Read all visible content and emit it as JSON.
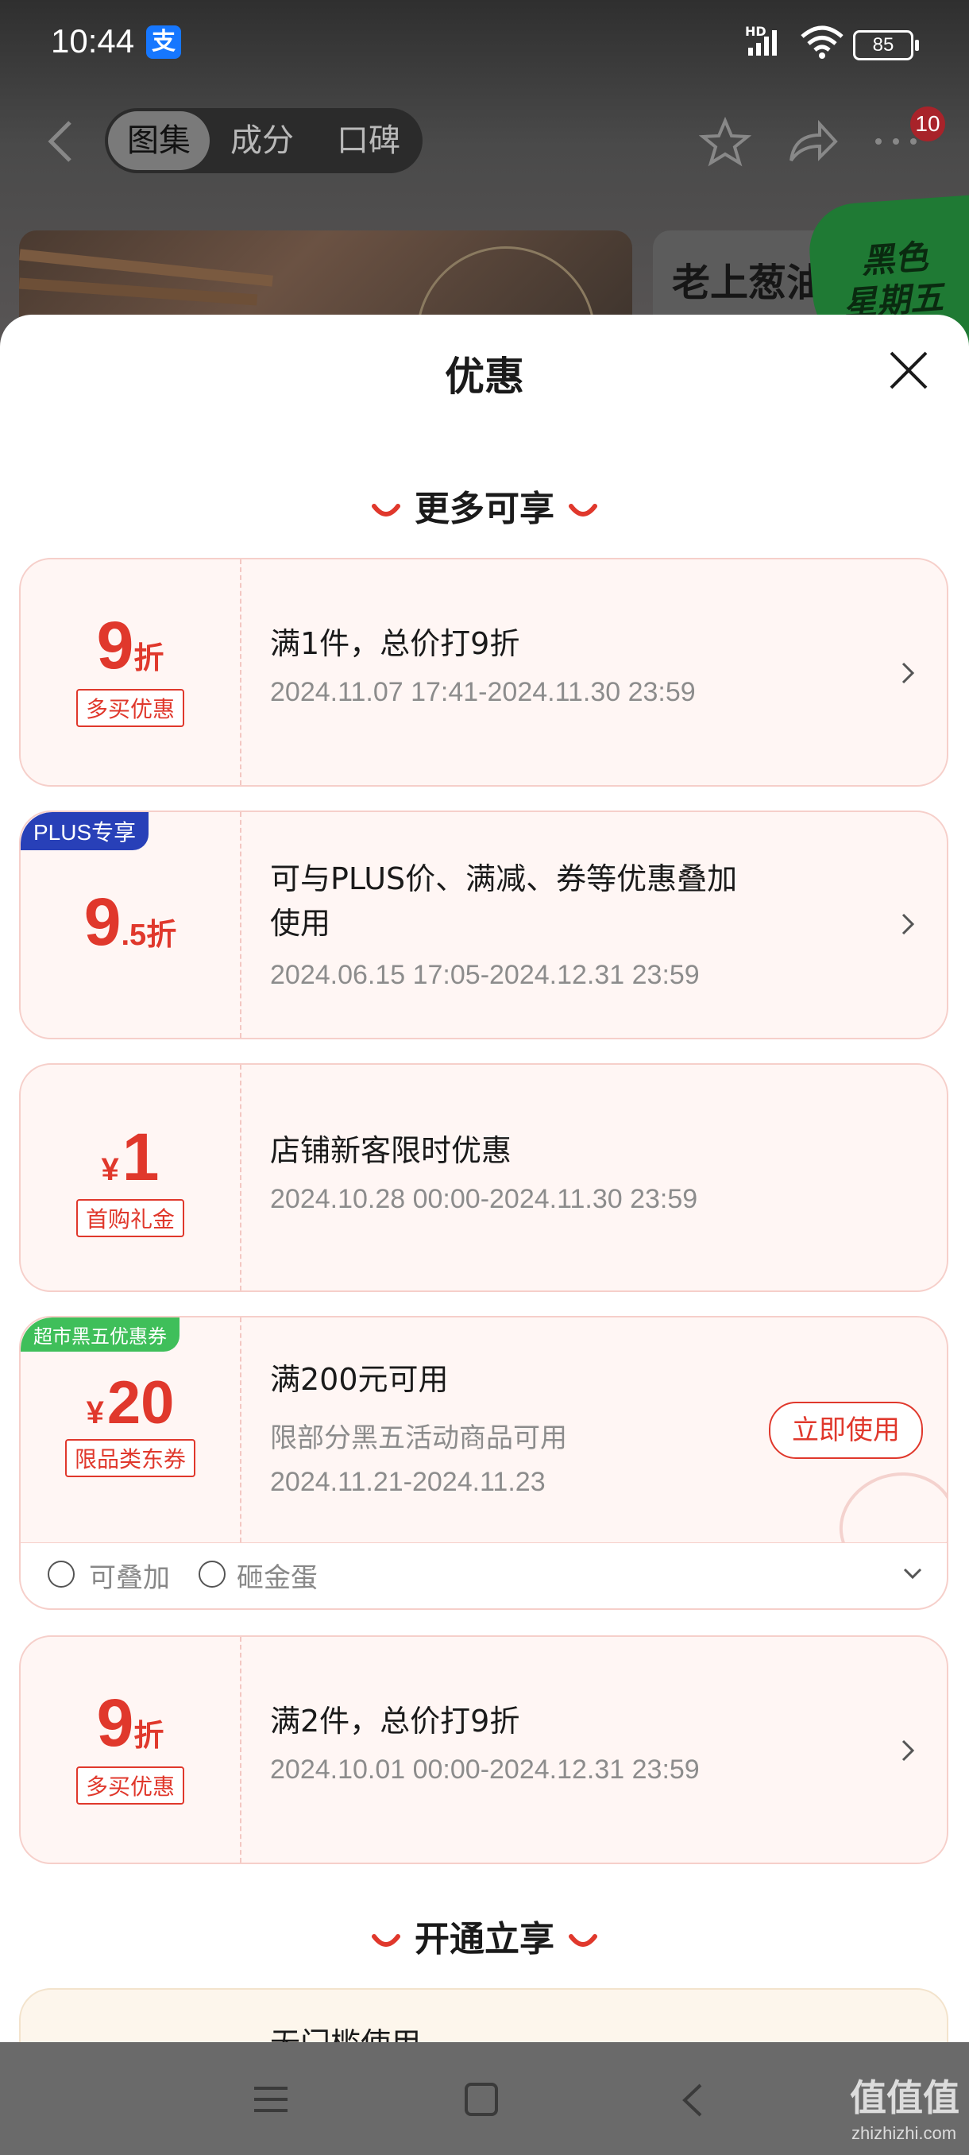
{
  "status": {
    "time": "10:44",
    "alipay_glyph": "支",
    "network": "HD",
    "battery": "85"
  },
  "topnav": {
    "tabs": [
      "图集",
      "成分",
      "口碑"
    ],
    "badge": "10",
    "banner_text": "老上葱油",
    "promo_line1": "黑色",
    "promo_line2": "星期五"
  },
  "sheet": {
    "title": "优惠",
    "section1": "更多可享",
    "section2": "开通立享",
    "coupons": [
      {
        "value": "9",
        "unit": "折",
        "tag": "多买优惠",
        "title": "满1件，总价打9折",
        "date": "2024.11.07 17:41-2024.11.30 23:59"
      },
      {
        "value": "9",
        "unit": ".5折",
        "corner": "PLUS专享",
        "title": "可与PLUS价、满减、券等优惠叠加",
        "title2": "使用",
        "date": "2024.06.15 17:05-2024.12.31 23:59"
      },
      {
        "currency": "¥",
        "value": "1",
        "tag": "首购礼金",
        "title": "店铺新客限时优惠",
        "date": "2024.10.28 00:00-2024.11.30 23:59"
      },
      {
        "currency": "¥",
        "value": "20",
        "corner": "超市黑五优惠券",
        "tag": "限品类东券",
        "title": "满200元可用",
        "desc": "限部分黑五活动商品可用",
        "date": "2024.11.21-2024.11.23",
        "button": "立即使用",
        "stackable": "可叠加",
        "egg": "砸金蛋"
      },
      {
        "value": "9",
        "unit": "折",
        "tag": "多买优惠",
        "title": "满2件，总价打9折",
        "date": "2024.10.01 00:00-2024.12.31 23:59"
      }
    ],
    "partial_text": "无门槛使用"
  },
  "colors": {
    "accent": "#e0382c",
    "plus_blue": "#2840b8",
    "blackfri_green": "#3fbf5a"
  },
  "watermark": {
    "main": "值值值",
    "sub": "zhizhizhi.com"
  }
}
